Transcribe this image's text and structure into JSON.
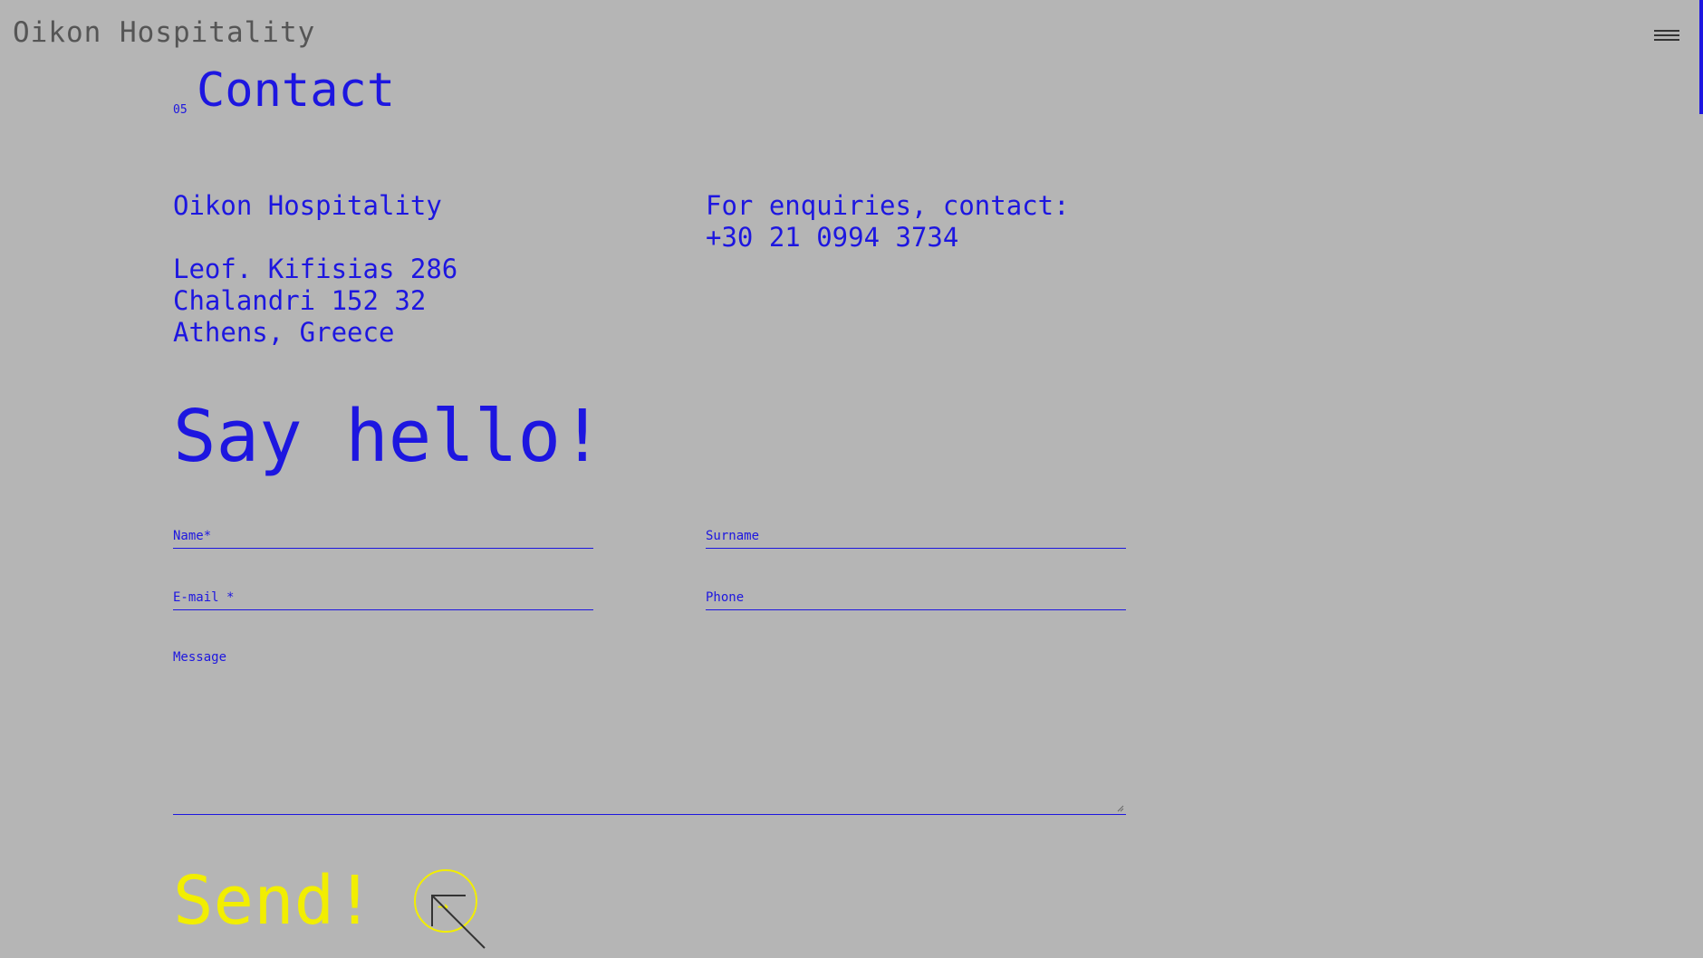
{
  "header": {
    "brand": "Oikon Hospitality",
    "menu_icon": "hamburger-icon"
  },
  "section": {
    "number": "05",
    "title": "Contact"
  },
  "company": {
    "name": "Oikon Hospitality",
    "address_line1": "Leof. Kifisias 286",
    "address_line2": "Chalandri 152 32",
    "address_line3": "Athens, Greece"
  },
  "enquiries": {
    "label": "For enquiries, contact:",
    "phone": "+30 21 0994 3734"
  },
  "form": {
    "heading": "Say hello!",
    "name_label": "Name*",
    "surname_label": "Surname",
    "email_label": "E-mail *",
    "phone_label": "Phone",
    "message_label": "Message",
    "submit_label": "Send!",
    "submit_icon": "arrow-right-icon"
  },
  "colors": {
    "background": "#b5b5b5",
    "accent": "#1d16e0",
    "submit": "#f2ee00",
    "brand_text": "#555555"
  }
}
